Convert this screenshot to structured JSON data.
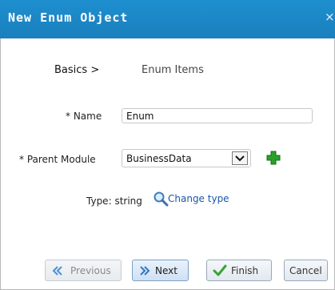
{
  "window": {
    "title": "New Enum Object",
    "close_glyph": "×"
  },
  "wizard": {
    "steps": [
      {
        "label": "Basics >"
      },
      {
        "label": "Enum Items"
      }
    ]
  },
  "form": {
    "name_label": "* Name",
    "name_value": "Enum",
    "parent_label": "* Parent Module",
    "parent_value": "BusinessData",
    "type_label": "Type:",
    "type_value": "string",
    "change_type_label": "Change type"
  },
  "buttons": {
    "previous": "Previous",
    "next": "Next",
    "finish": "Finish",
    "cancel": "Cancel"
  },
  "colors": {
    "titlebar": "#1a86c7",
    "link": "#1a56a8",
    "add_green": "#2aa02a"
  },
  "icons": {
    "close": "close-icon",
    "add": "plus-icon",
    "search": "magnifier-icon",
    "previous": "double-chevron-left-icon",
    "next": "double-chevron-right-icon",
    "finish": "checkmark-icon"
  }
}
